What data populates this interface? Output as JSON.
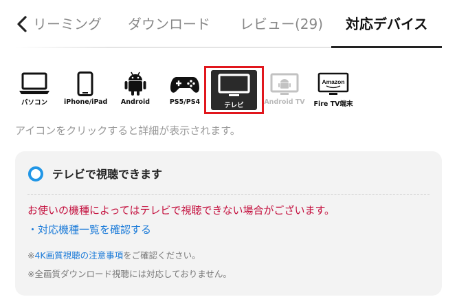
{
  "tabs": {
    "stream": "リーミング",
    "download": "ダウンロード",
    "review": "レビュー(29)",
    "devices": "対応デバイス"
  },
  "devices": {
    "pc": "パソコン",
    "iphone": "iPhone/iPad",
    "android": "Android",
    "ps": "PS5/PS4",
    "tv": "テレビ",
    "androidtv": "Android TV",
    "firetv": "Fire TV端末",
    "firetv_logo": "Amazon",
    "selected": "tv"
  },
  "hint": "アイコンをクリックすると詳細が表示されます。",
  "card": {
    "title": "テレビで視聴できます",
    "warning": "お使いの機種によってはテレビで視聴できない場合がございます。",
    "link": "・対応機種一覧を確認する",
    "note1_prefix": "※",
    "note1_link": "4K画質視聴の注意事項",
    "note1_suffix": "をご確認ください。",
    "note2": "※全画質ダウンロード視聴には対応しておりません。"
  },
  "colors": {
    "accent_blue": "#2196e6",
    "warning_red": "#c4103e",
    "selected_border": "#e1171d"
  }
}
